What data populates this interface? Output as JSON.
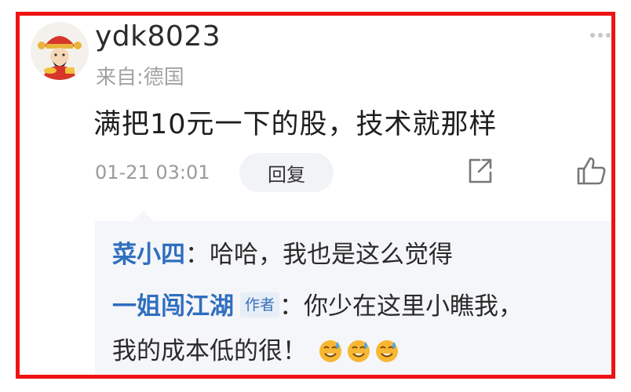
{
  "comment": {
    "username": "ydk8023",
    "location": "来自:德国",
    "content": "满把10元一下的股，技术就那样",
    "timestamp": "01-21 03:01",
    "reply_label": "回复",
    "more_icon": "more-dots-icon",
    "share_icon": "share-icon",
    "like_icon": "thumbs-up-icon"
  },
  "replies": [
    {
      "nickname": "菜小四",
      "text": "：哈哈，我也是这么觉得"
    },
    {
      "nickname": "一姐闯江湖",
      "badge": "作者",
      "text": "：你少在这里小瞧我，",
      "text_cont": "我的成本低的很！",
      "emojis": [
        "sweat-smile-emoji",
        "sweat-smile-emoji",
        "sweat-smile-emoji"
      ]
    }
  ],
  "colors": {
    "frame": "#ef1313",
    "nickname": "#2f6ebf",
    "reply_bg": "#f5f6f9"
  }
}
